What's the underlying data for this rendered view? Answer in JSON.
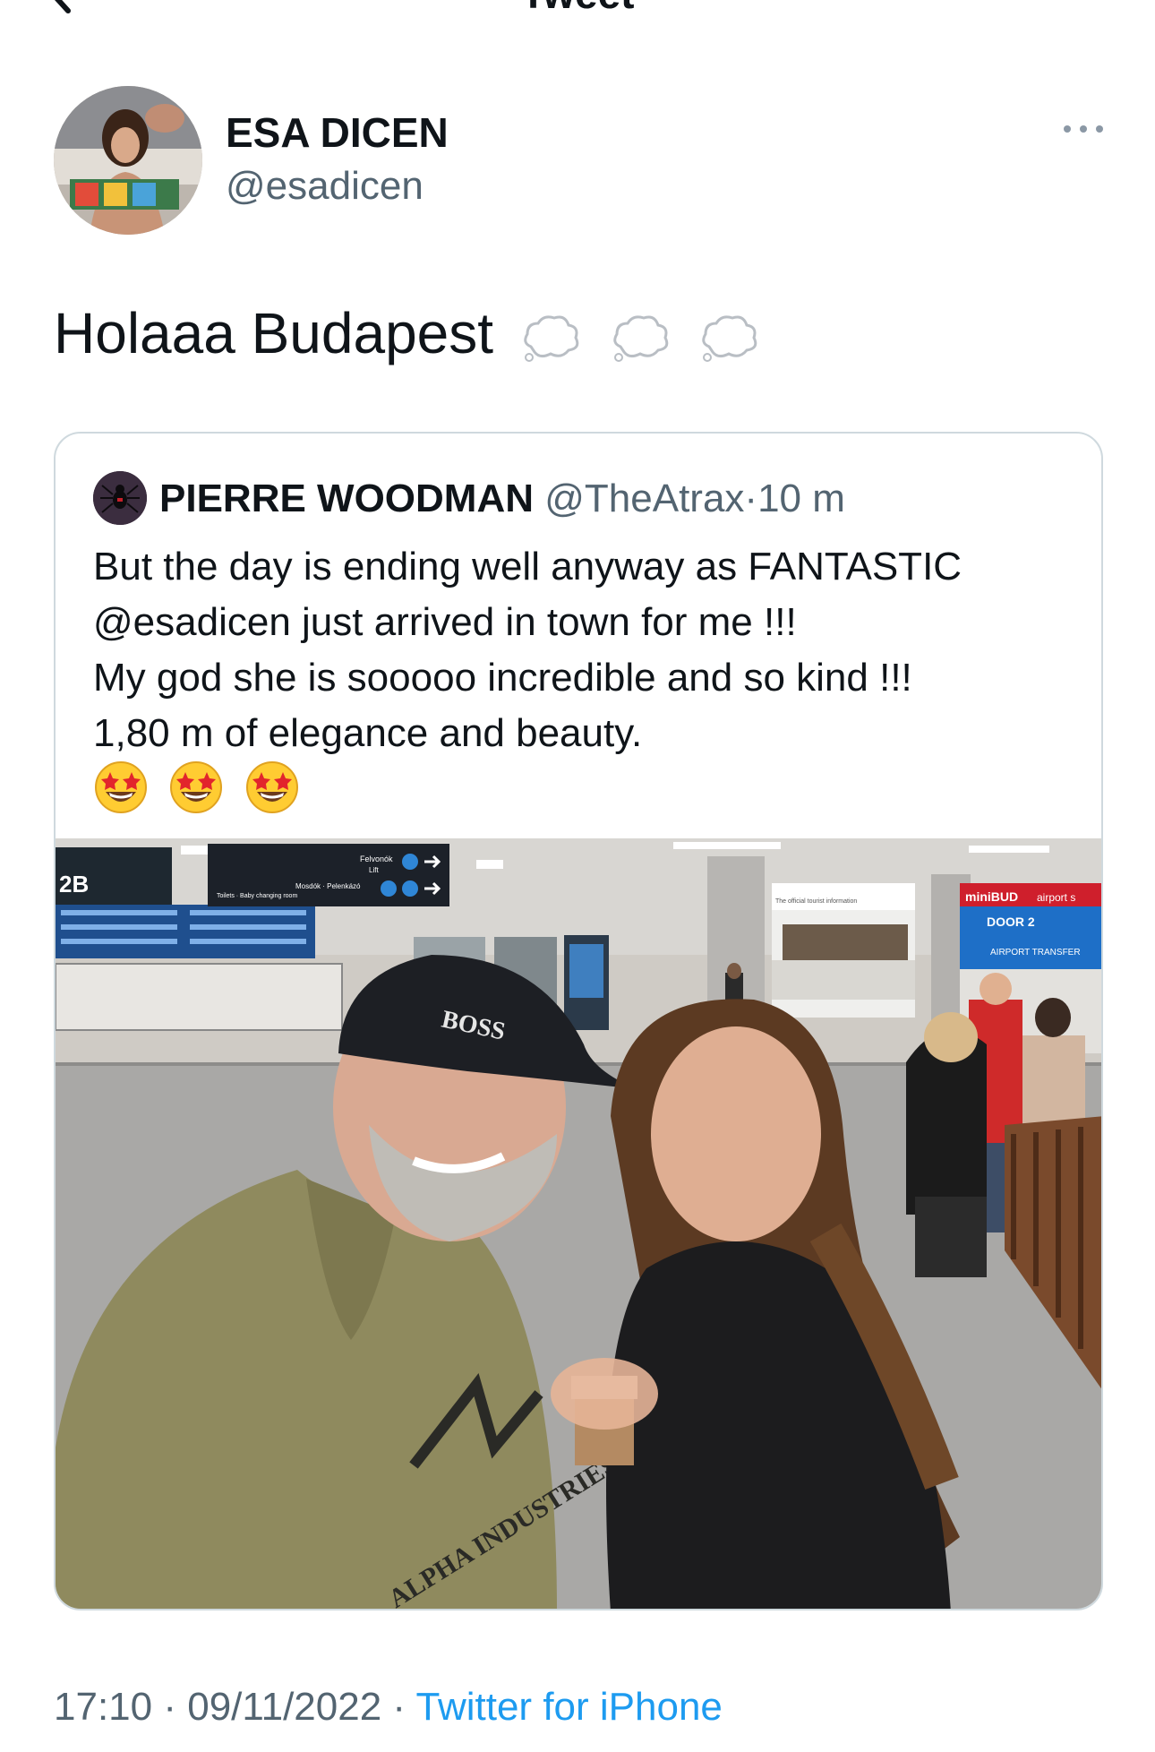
{
  "header": {
    "title": "Tweet"
  },
  "author": {
    "name": "ESA DICEN",
    "handle": "@esadicen"
  },
  "tweet": {
    "text": "Holaaa Budapest",
    "emojis": [
      "dashing-away-icon",
      "dashing-away-icon",
      "dashing-away-icon"
    ]
  },
  "quoted": {
    "name": "PIERRE WOODMAN",
    "handle": "@TheAtrax",
    "separator": "·",
    "time": "10 m",
    "lines": [
      "But the day is ending well anyway as FANTASTIC",
      "@esadicen just arrived in town for me !!!",
      "My god she is sooooo incredible and so kind !!!",
      "1,80 m of elegance and beauty."
    ],
    "emojis": [
      "star-struck-icon",
      "star-struck-icon",
      "star-struck-icon"
    ],
    "photo": {
      "signs": {
        "sign_1": "Felvonók",
        "sign_2": "Lift",
        "sign_3": "Mosdók · Pelenkázó",
        "sign_4": "Toilets · Baby changing room",
        "gate": "2B",
        "brand": "miniBUD",
        "brand_tag": "airport s",
        "door": "DOOR 2",
        "airport_transfer": "AIRPORT TRANSFER",
        "info_desk": "The official tourist information",
        "cap_logo": "BOSS",
        "hoodie_logo": "ALPHA INDUSTRIES"
      }
    }
  },
  "footer": {
    "time": "17:10",
    "sep1": "·",
    "date": "09/11/2022",
    "sep2": "·",
    "source": "Twitter for iPhone"
  }
}
